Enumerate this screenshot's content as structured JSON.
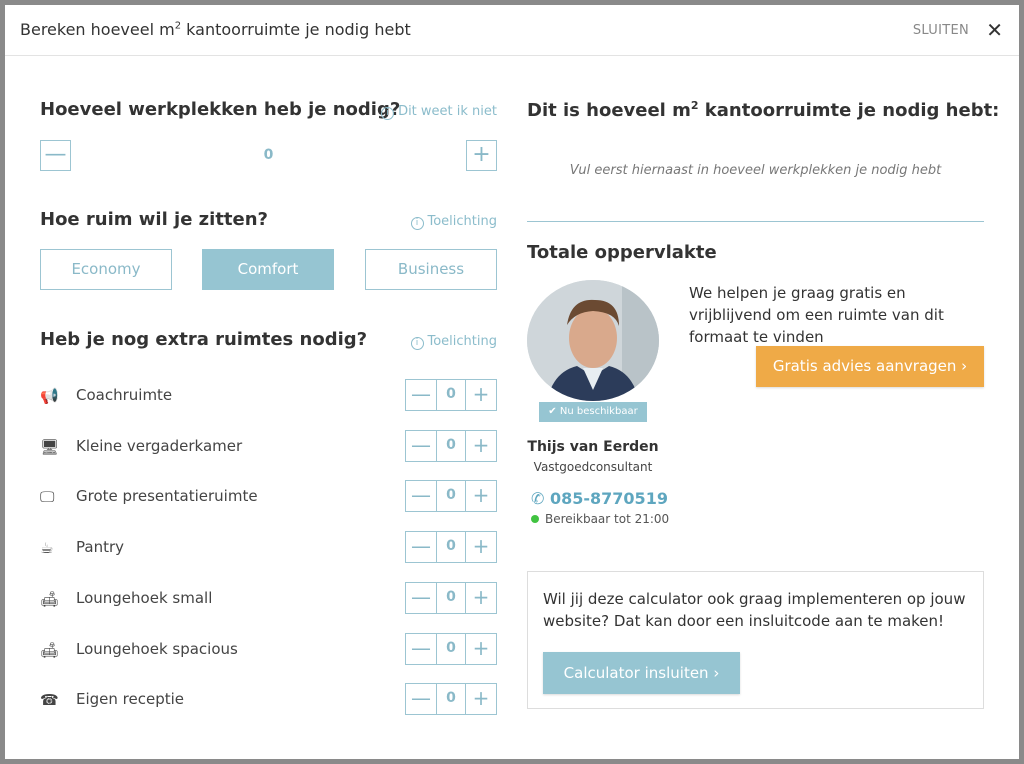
{
  "header": {
    "title_pre": "Bereken hoeveel m",
    "title_sup": "2",
    "title_post": " kantoorruimte je nodig hebt",
    "close_label": "SLUITEN",
    "close_icon": "close-icon"
  },
  "workplaces": {
    "title": "Hoeveel werkplekken heb je nodig?",
    "help": "Dit weet ik niet",
    "value": "0",
    "minus": "—",
    "plus": "+"
  },
  "comfort": {
    "title": "Hoe ruim wil je zitten?",
    "help": "Toelichting",
    "options": [
      "Economy",
      "Comfort",
      "Business"
    ],
    "selected": "Comfort"
  },
  "extra": {
    "title": "Heb je nog extra ruimtes nodig?",
    "help": "Toelichting",
    "rooms": [
      {
        "label": "Coachruimte",
        "value": "0",
        "icon": "megaphone-icon",
        "glyph": "📢"
      },
      {
        "label": "Kleine vergaderkamer",
        "value": "0",
        "icon": "monitor-small-icon",
        "glyph": "🖥"
      },
      {
        "label": "Grote presentatieruimte",
        "value": "0",
        "icon": "monitor-large-icon",
        "glyph": "🖵"
      },
      {
        "label": "Pantry",
        "value": "0",
        "icon": "coffee-icon",
        "glyph": "☕"
      },
      {
        "label": "Loungehoek small",
        "value": "0",
        "icon": "armchair-icon",
        "glyph": "🛋"
      },
      {
        "label": "Loungehoek spacious",
        "value": "0",
        "icon": "sofa-icon",
        "glyph": "🛋"
      },
      {
        "label": "Eigen receptie",
        "value": "0",
        "icon": "phone-desk-icon",
        "glyph": "☎"
      }
    ]
  },
  "result": {
    "title_pre": "Dit is hoeveel m",
    "title_sup": "2",
    "title_post": " kantoorruimte je nodig hebt:",
    "hint": "Vul eerst hiernaast in hoeveel werkplekken je nodig hebt",
    "total_title": "Totale oppervlakte"
  },
  "consultant": {
    "badge": "Nu beschikbaar",
    "name": "Thijs van Eerden",
    "role": "Vastgoedconsultant",
    "phone": "085-8770519",
    "availability": "Bereikbaar tot 21:00",
    "help_text": "We helpen je graag gratis en vrijblijvend om een ruimte van dit formaat te vinden",
    "cta": "Gratis advies aanvragen  ›"
  },
  "embed": {
    "text": "Wil jij deze calculator ook graag implementeren op jouw website? Dat kan door een insluitcode aan te maken!",
    "button": "Calculator insluiten  ›"
  },
  "colors": {
    "accent": "#96c5d2",
    "orange": "#efaa47",
    "green": "#41c341"
  }
}
